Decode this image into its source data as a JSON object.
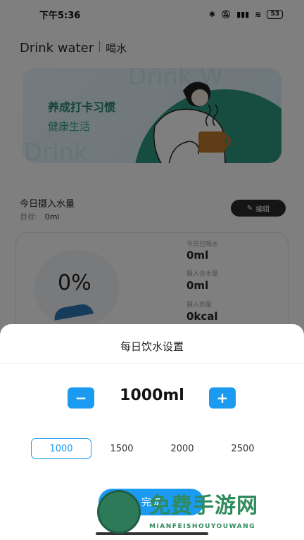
{
  "status_bar": {
    "time": "下午5:36",
    "battery": "53"
  },
  "header": {
    "title_en": "Drink water",
    "title_cn": "喝水"
  },
  "banner": {
    "line1": "养成打卡习惯",
    "line2": "健康生活",
    "watermark_top": "Drink W",
    "watermark_bottom": "Drink"
  },
  "intake": {
    "title": "今日摄入水量",
    "target_label": "目标:",
    "target_value": "0ml",
    "edit_label": "编辑",
    "gauge_percent": "0%",
    "stats": [
      {
        "label": "今日已喝水",
        "value": "0ml"
      },
      {
        "label": "摄入含水量",
        "value": "0ml"
      },
      {
        "label": "摄入热量",
        "value": "0kcal"
      }
    ]
  },
  "sheet": {
    "title": "每日饮水设置",
    "minus_label": "−",
    "plus_label": "+",
    "amount": "1000ml",
    "presets": [
      "1000",
      "1500",
      "2000",
      "2500"
    ],
    "selected_preset": "1000",
    "done_label": "完成"
  },
  "watermark": {
    "text": "免费手游网",
    "sub": "MIANFEISHOUYOUWANG"
  },
  "colors": {
    "accent": "#1a9af0",
    "banner_green": "#2f9a82",
    "dark_button": "#2a2a2a"
  }
}
